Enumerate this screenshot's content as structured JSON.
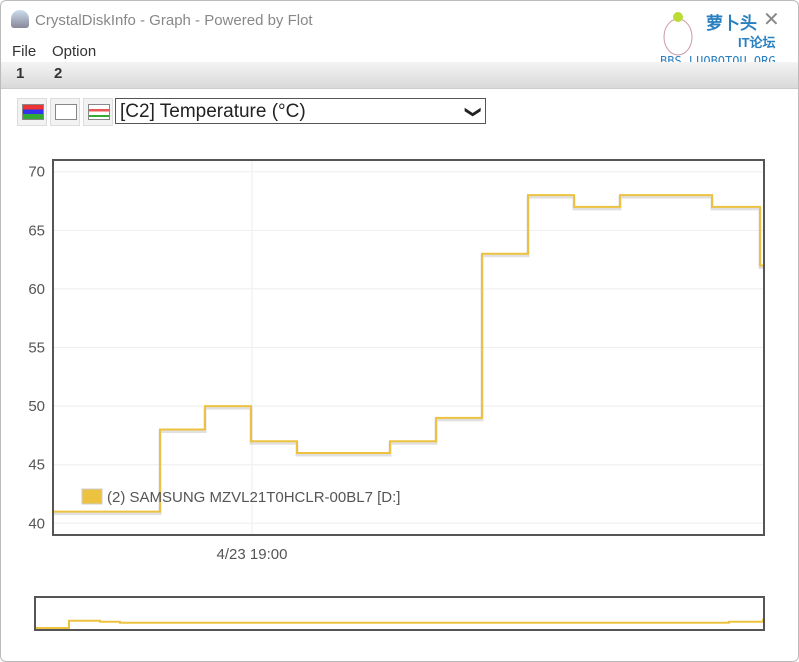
{
  "window": {
    "title": "CrystalDiskInfo - Graph - Powered by Flot",
    "close_icon": "close-icon"
  },
  "menu": [
    "File",
    "Option"
  ],
  "tabs": [
    "1",
    "2"
  ],
  "toolbar": {
    "buttons": [
      "all-graph-icon",
      "blank-graph-icon",
      "temperature-graph-icon"
    ],
    "selected_attribute": "[C2] Temperature (°C)"
  },
  "watermark": {
    "text": "萝卜头 IT论坛 BBS.LUOBOTOU.ORG"
  },
  "chart_data": {
    "type": "line",
    "step": true,
    "grid": true,
    "ylim": [
      39,
      71
    ],
    "y_ticks": [
      "40",
      "45",
      "50",
      "55",
      "60",
      "65",
      "70"
    ],
    "x_ticks": [
      "4/23 19:00"
    ],
    "legend": "bottom-left",
    "series": [
      {
        "name": "(2) SAMSUNG MZVL21T0HCLR-00BL7 [D:]",
        "color": "#edc240",
        "values": [
          41,
          41,
          48,
          50,
          47,
          46,
          46,
          47,
          49,
          63,
          68,
          67,
          68,
          68,
          67,
          62
        ]
      }
    ]
  }
}
